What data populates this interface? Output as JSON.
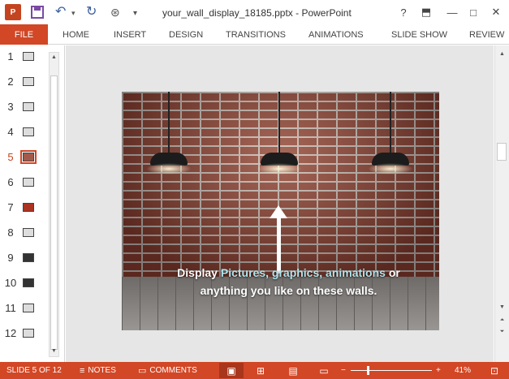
{
  "window": {
    "title": "your_wall_display_18185.pptx - PowerPoint",
    "logo_letter": "P",
    "help": "?",
    "restore_ribbon": "⬒",
    "minimize": "—",
    "maximize": "□",
    "close": "✕"
  },
  "quick_access": {
    "save": "save-icon",
    "undo": "↶",
    "undo_dropdown": "▾",
    "redo": "↻",
    "present": "⊛",
    "more": "▾"
  },
  "ribbon": {
    "file": "FILE",
    "tabs": [
      "HOME",
      "INSERT",
      "DESIGN",
      "TRANSITIONS",
      "ANIMATIONS",
      "SLIDE SHOW",
      "REVIEW"
    ]
  },
  "thumbnails": {
    "items": [
      {
        "num": "1"
      },
      {
        "num": "2"
      },
      {
        "num": "3"
      },
      {
        "num": "4"
      },
      {
        "num": "5",
        "active": true
      },
      {
        "num": "6"
      },
      {
        "num": "7"
      },
      {
        "num": "8"
      },
      {
        "num": "9"
      },
      {
        "num": "10"
      },
      {
        "num": "11"
      },
      {
        "num": "12"
      }
    ]
  },
  "slide": {
    "text_line1_prefix": "Display ",
    "text_line1_highlight": "Pictures, graphics, animations",
    "text_line1_suffix": " or",
    "text_line2": "anything you like on these walls."
  },
  "statusbar": {
    "slide_info": "SLIDE 5 OF 12",
    "notes": "NOTES",
    "comments": "COMMENTS",
    "zoom_out": "−",
    "zoom_in": "+",
    "zoom": "41%",
    "accent": "#d24726"
  }
}
